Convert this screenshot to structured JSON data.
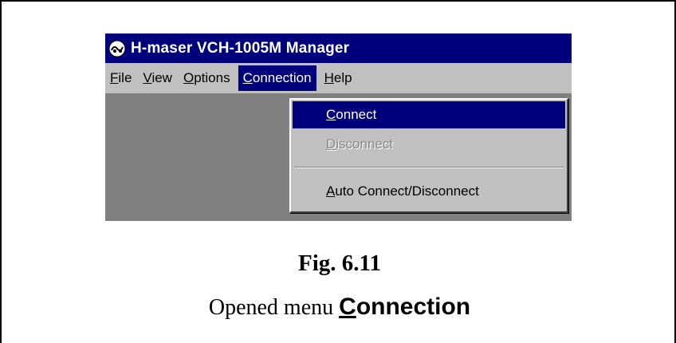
{
  "window": {
    "title": "H-maser VCH-1005M Manager",
    "icon": "app-icon",
    "titlebar_color": "#00007c"
  },
  "menubar": {
    "items": [
      {
        "accel": "F",
        "rest": "ile"
      },
      {
        "accel": "V",
        "rest": "iew"
      },
      {
        "accel": "O",
        "rest": "ptions"
      },
      {
        "accel": "C",
        "rest": "onnection"
      },
      {
        "accel": "H",
        "rest": "elp"
      }
    ],
    "open_item": "Connection"
  },
  "dropdown": {
    "items": [
      {
        "accel": "C",
        "rest": "onnect",
        "state": "selected"
      },
      {
        "accel": "D",
        "rest": "isconnect",
        "state": "disabled"
      },
      {
        "pre": "",
        "accel": "A",
        "rest": "uto Connect/Disconnect",
        "state": "normal"
      }
    ],
    "highlight_color": "#00007c"
  },
  "caption": {
    "figure": "Fig. 6.11",
    "text": "Opened menu",
    "menu_accel": "C",
    "menu_rest": "onnection"
  }
}
